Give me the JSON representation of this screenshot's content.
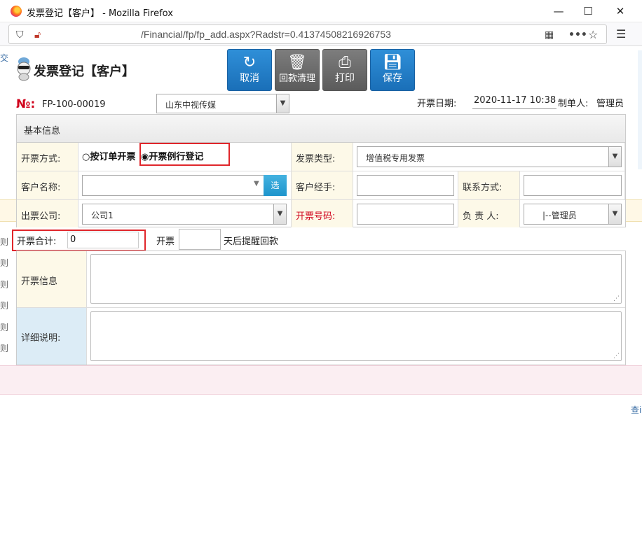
{
  "window": {
    "title": "发票登记【客户】 - Mozilla Firefox",
    "minimize": "—",
    "maximize": "☐",
    "close": "✕"
  },
  "urlbar": {
    "url": "/Financial/fp/fp_add.aspx?Radstr=0.41374508216926753",
    "menu_icon": "hamburger-menu-icon"
  },
  "background": {
    "left_glyphs": [
      "交",
      "则",
      "则",
      "则",
      "则",
      "则",
      "则"
    ],
    "right_glyph": "查i"
  },
  "header": {
    "title": "发票登记【客户】",
    "no_label": "№:",
    "no_value": "FP-100-00019",
    "company_select": "山东中视传媒",
    "date_label": "开票日期:",
    "date_value": "2020-11-17 10:38",
    "maker_label": "制单人:",
    "maker_value": "管理员"
  },
  "toolbar": {
    "cancel": "取消",
    "clear": "回款清理",
    "print": "打印",
    "save": "保存"
  },
  "form": {
    "section_title": "基本信息",
    "invoice_method_label": "开票方式:",
    "radio_by_order": "按订单开票",
    "radio_routine": "开票例行登记",
    "invoice_type_label": "发票类型:",
    "invoice_type_value": "增值税专用发票",
    "customer_name_label": "客户名称:",
    "customer_name_value": "",
    "pick_button": "选",
    "customer_handler_label": "客户经手:",
    "contact_label": "联系方式:",
    "issuing_company_label": "出票公司:",
    "issuing_company_value": "公司1",
    "invoice_number_label": "开票号码:",
    "responsible_label": "负 责 人:",
    "responsible_value": "|--管理员",
    "total_label": "开票合计:",
    "total_value": "0",
    "remind_prefix": "开票",
    "remind_suffix": "天后提醒回款",
    "invoice_info_label": "开票信息",
    "detail_label": "详细说明:"
  }
}
